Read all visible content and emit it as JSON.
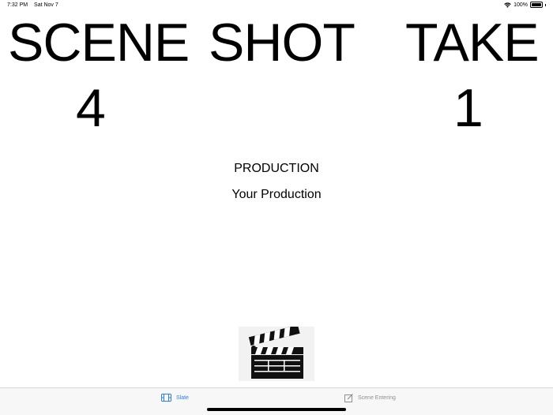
{
  "status_bar": {
    "time": "7:32 PM",
    "date": "Sat Nov 7",
    "battery": "100%"
  },
  "slate": {
    "labels": {
      "scene": "SCENE",
      "shot": "SHOT",
      "take": "TAKE"
    },
    "values": {
      "scene": "4",
      "shot": "",
      "take": "1"
    }
  },
  "production": {
    "title": "PRODUCTION",
    "name": "Your Production"
  },
  "tabs": [
    {
      "label": "Slate",
      "icon": "film-icon",
      "active": true
    },
    {
      "label": "Scene Entering",
      "icon": "edit-icon",
      "active": false
    }
  ],
  "colors": {
    "active_tab": "#2a7ef0",
    "inactive_tab": "#8e8e93"
  }
}
